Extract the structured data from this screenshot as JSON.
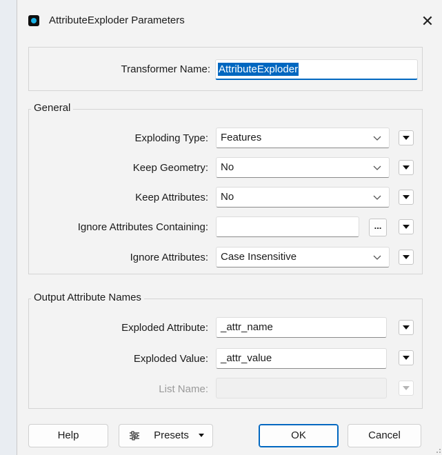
{
  "window": {
    "title": "AttributeExploder Parameters",
    "close_glyph": "✕"
  },
  "transformer": {
    "label": "Transformer Name:",
    "value": "AttributeExploder"
  },
  "general": {
    "title": "General",
    "exploding_type": {
      "label": "Exploding Type:",
      "value": "Features"
    },
    "keep_geometry": {
      "label": "Keep Geometry:",
      "value": "No"
    },
    "keep_attributes": {
      "label": "Keep Attributes:",
      "value": "No"
    },
    "ignore_containing": {
      "label": "Ignore Attributes Containing:",
      "value": "",
      "browse_label": "..."
    },
    "ignore_attributes": {
      "label": "Ignore Attributes:",
      "value": "Case Insensitive"
    }
  },
  "output": {
    "title": "Output Attribute Names",
    "exploded_attribute": {
      "label": "Exploded Attribute:",
      "value": "_attr_name"
    },
    "exploded_value": {
      "label": "Exploded Value:",
      "value": "_attr_value"
    },
    "list_name": {
      "label": "List Name:",
      "value": "",
      "enabled": false
    }
  },
  "buttons": {
    "help": "Help",
    "presets": "Presets",
    "ok": "OK",
    "cancel": "Cancel"
  },
  "icons": {
    "app": "app-icon",
    "close": "close-icon",
    "chevron": "chevron-down-icon",
    "menu": "menu-triangle-icon",
    "presets": "sliders-icon"
  },
  "colors": {
    "accent": "#0067c0",
    "app_icon_inner": "#19b2e6"
  }
}
